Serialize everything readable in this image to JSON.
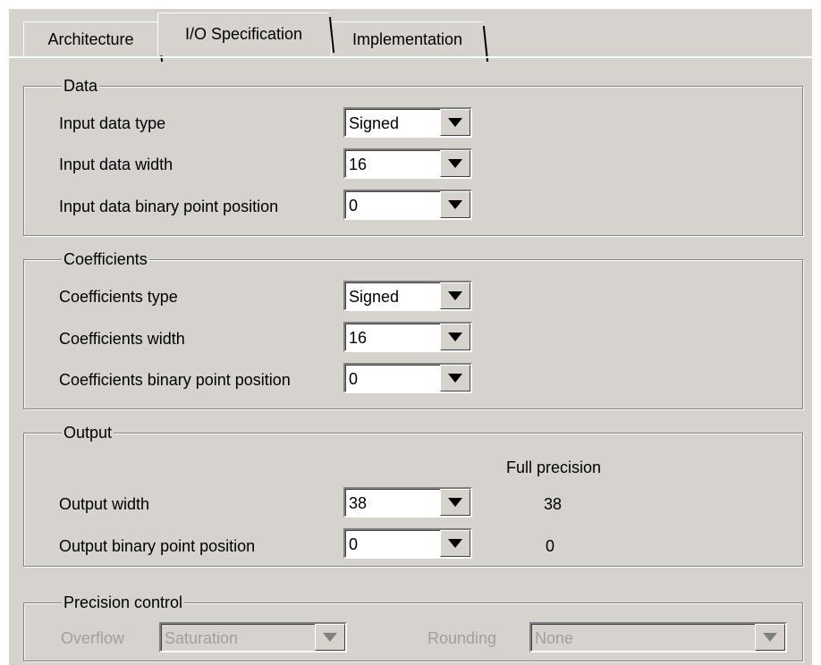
{
  "tabs": [
    {
      "label": "Architecture"
    },
    {
      "label": "I/O Specification"
    },
    {
      "label": "Implementation"
    }
  ],
  "data_group": {
    "title": "Data",
    "rows": [
      {
        "label": "Input data type",
        "value": "Signed"
      },
      {
        "label": "Input data width",
        "value": "16"
      },
      {
        "label": "Input data binary point position",
        "value": "0"
      }
    ]
  },
  "coeff_group": {
    "title": "Coefficients",
    "rows": [
      {
        "label": "Coefficients type",
        "value": "Signed"
      },
      {
        "label": "Coefficients width",
        "value": "16"
      },
      {
        "label": "Coefficients binary point position",
        "value": "0"
      }
    ]
  },
  "output_group": {
    "title": "Output",
    "full_precision_header": "Full precision",
    "rows": [
      {
        "label": "Output width",
        "value": "38",
        "full_precision": "38"
      },
      {
        "label": "Output binary point position",
        "value": "0",
        "full_precision": "0"
      }
    ]
  },
  "precision_group": {
    "title": "Precision control",
    "overflow_label": "Overflow",
    "overflow_value": "Saturation",
    "rounding_label": "Rounding",
    "rounding_value": "None"
  },
  "colors": {
    "panel": "#d6d3ce",
    "disabled_text": "#a0a0a0"
  }
}
